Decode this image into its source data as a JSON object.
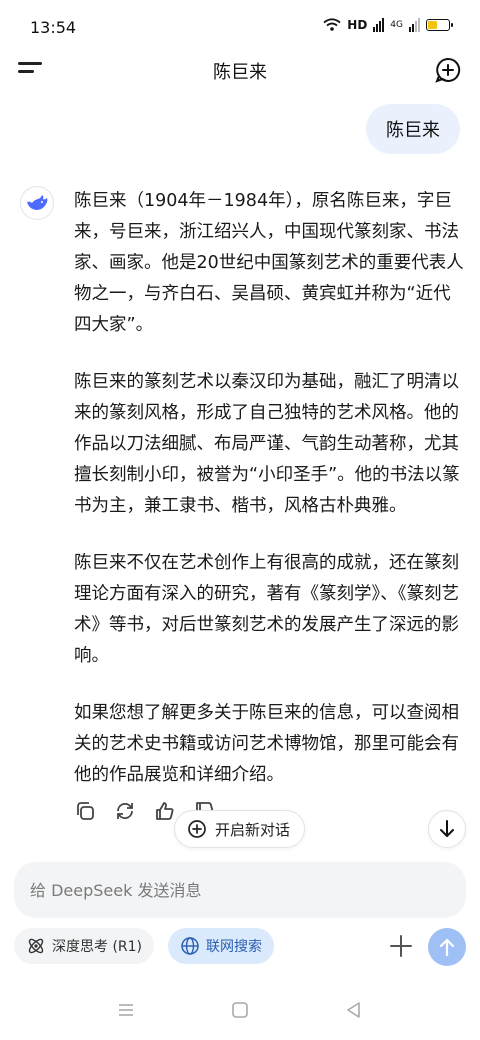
{
  "status": {
    "time": "13:54",
    "network": "HD",
    "network_type": "4G"
  },
  "header": {
    "title": "陈巨来"
  },
  "user_message": "陈巨来",
  "answer_paragraphs": [
    "陈巨来（1904年－1984年），原名陈巨来，字巨来，号巨来，浙江绍兴人，中国现代篆刻家、书法家、画家。他是20世纪中国篆刻艺术的重要代表人物之一，与齐白石、吴昌硕、黄宾虹并称为“近代四大家”。",
    "陈巨来的篆刻艺术以秦汉印为基础，融汇了明清以来的篆刻风格，形成了自己独特的艺术风格。他的作品以刀法细腻、布局严谨、气韵生动著称，尤其擅长刻制小印，被誉为“小印圣手”。他的书法以篆书为主，兼工隶书、楷书，风格古朴典雅。",
    "陈巨来不仅在艺术创作上有很高的成就，还在篆刻理论方面有深入的研究，著有《篆刻学》、《篆刻艺术》等书，对后世篆刻艺术的发展产生了深远的影响。",
    "如果您想了解更多关于陈巨来的信息，可以查阅相关的艺术史书籍或访问艺术博物馆，那里可能会有他的作品展览和详细介绍。"
  ],
  "new_chat_button": {
    "label": "开启新对话"
  },
  "input": {
    "placeholder": "给 DeepSeek 发送消息",
    "value": ""
  },
  "chips": {
    "deep_think": "深度思考 (R1)",
    "web_search": "联网搜索"
  },
  "colors": {
    "accent": "#4d6bfe",
    "search_chip_bg": "#dbe9fd",
    "send_button": "#9fc0f5",
    "battery": "#f1c40f"
  },
  "icons": [
    "menu-icon",
    "new-chat-icon",
    "deepseek-whale-icon",
    "copy-icon",
    "regenerate-icon",
    "thumb-up-icon",
    "thumb-down-icon",
    "arrow-down-icon",
    "atom-icon",
    "globe-icon",
    "plus-icon",
    "send-arrow-icon"
  ]
}
